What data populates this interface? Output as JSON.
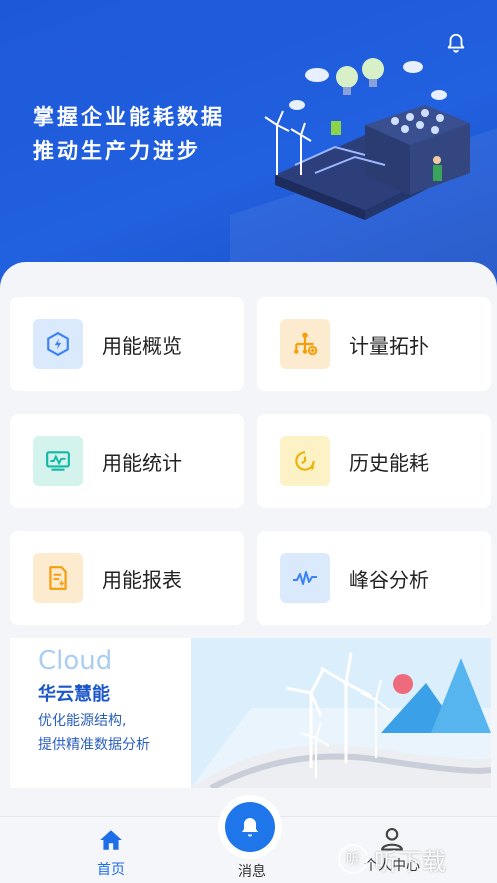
{
  "hero": {
    "title_line1": "掌握企业能耗数据",
    "title_line2": "推动生产力进步"
  },
  "menu": [
    {
      "label": "用能概览",
      "icon": "energy-overview-icon",
      "color": "#3b82f6",
      "bg": "#dbe9fd"
    },
    {
      "label": "计量拓扑",
      "icon": "topology-icon",
      "color": "#f59e0b",
      "bg": "#fdebcf"
    },
    {
      "label": "用能统计",
      "icon": "statistics-monitor-icon",
      "color": "#14b8a6",
      "bg": "#d3f3ec"
    },
    {
      "label": "历史能耗",
      "icon": "history-clock-icon",
      "color": "#eab308",
      "bg": "#fdf1c6"
    },
    {
      "label": "用能报表",
      "icon": "report-icon",
      "color": "#f59e0b",
      "bg": "#fdebcf"
    },
    {
      "label": "峰谷分析",
      "icon": "peak-valley-wave-icon",
      "color": "#3b82f6",
      "bg": "#dbe9fd"
    }
  ],
  "banner": {
    "title": "Cloud",
    "subtitle": "华云慧能",
    "line1": "优化能源结构,",
    "line2": "提供精准数据分析"
  },
  "tabbar": {
    "home": "首页",
    "messages": "消息",
    "profile": "个人中心"
  },
  "watermark": "听下载",
  "colors": {
    "primary": "#1d58d8",
    "active_tab": "#1e6ee8"
  }
}
